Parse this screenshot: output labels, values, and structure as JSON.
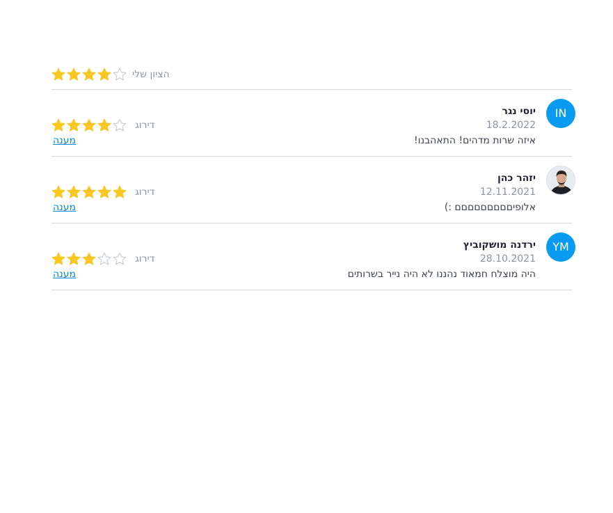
{
  "my_rating": {
    "label": "הציון שלי",
    "stars": 4,
    "max": 5
  },
  "colors": {
    "star_filled": "#f9c622",
    "star_empty": "#c9ced6",
    "avatar_bg": "#0a9bf0",
    "link": "#0a84d6"
  },
  "reviews": [
    {
      "avatar_initials": "IN",
      "name": "יוסי נגר",
      "date": "18.2.2022",
      "comment": "איזה שרות מדהים! התאהבנו!",
      "rating_label": "דירוג",
      "stars": 4,
      "reply_label": "מענה"
    },
    {
      "avatar_initials": "",
      "avatar_icon": "user-photo",
      "name": "יזהר כהן",
      "date": "12.11.2021",
      "comment": "אלופיםםםםםםםםם :)",
      "rating_label": "דירוג",
      "stars": 5,
      "reply_label": "מענה"
    },
    {
      "avatar_initials": "YM",
      "name": "ירדנה מושקוביץ",
      "date": "28.10.2021",
      "comment": "היה מוצלח חמאוד נהננו לא היה נייר בשרותים",
      "rating_label": "דירוג",
      "stars": 3,
      "reply_label": "מענה"
    }
  ]
}
